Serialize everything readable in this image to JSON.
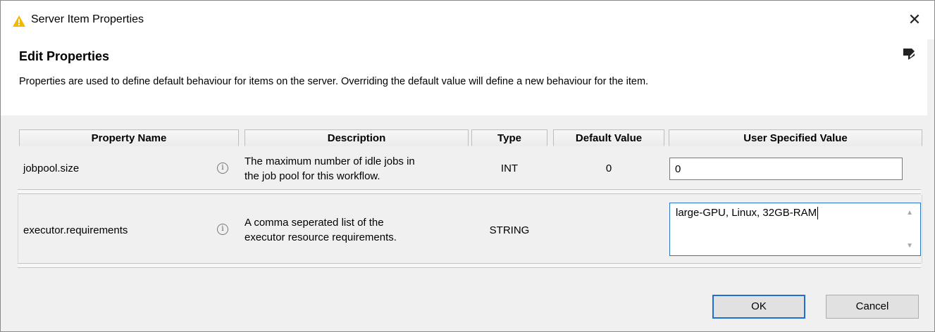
{
  "window": {
    "title": "Server Item Properties"
  },
  "banner": {
    "title": "Edit Properties",
    "description": "Properties are used to define default behaviour for items on the server. Overriding the default value will define a new behaviour for the item."
  },
  "table": {
    "headers": [
      "Property Name",
      "Description",
      "Type",
      "Default Value",
      "User Specified Value"
    ],
    "rows": [
      {
        "name": "jobpool.size",
        "description_line1": "The maximum number of idle jobs in",
        "description_line2": "the job pool for this workflow.",
        "type": "INT",
        "default": "0",
        "user_value": "0"
      },
      {
        "name": "executor.requirements",
        "description_line1": "A comma seperated list of the",
        "description_line2": "executor resource requirements.",
        "type": "STRING",
        "default": "",
        "user_value": "large-GPU, Linux, 32GB-RAM"
      }
    ]
  },
  "buttons": {
    "ok": "OK",
    "cancel": "Cancel"
  },
  "icons": {
    "app": "warning-triangle-icon",
    "close": "close-icon",
    "edit": "edit-note-icon",
    "info": "info-icon"
  },
  "colors": {
    "accent": "#1f6fd0",
    "warning": "#f5b800"
  }
}
